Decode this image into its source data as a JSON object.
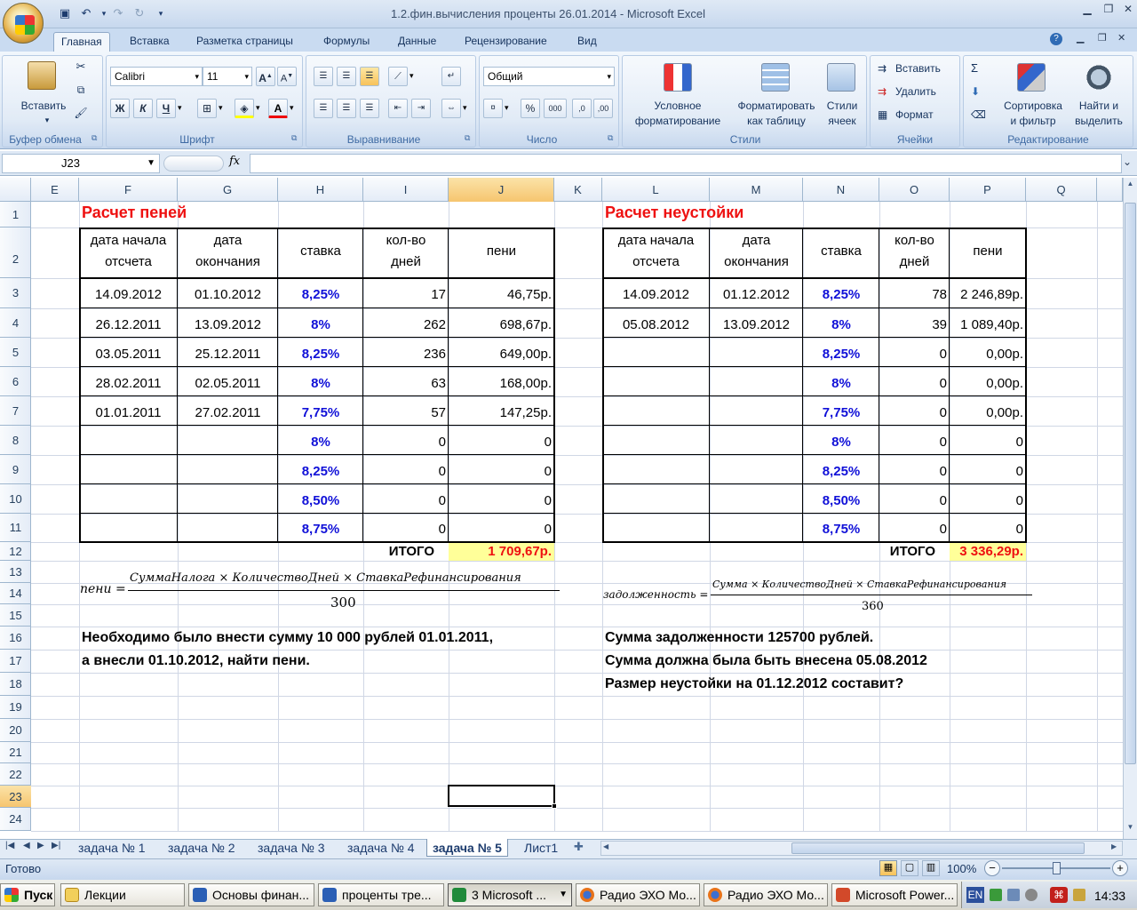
{
  "window": {
    "title": "1.2.фин.вычисления проценты 26.01.2014 - Microsoft Excel"
  },
  "ribbon": {
    "tabs": [
      "Главная",
      "Вставка",
      "Разметка страницы",
      "Формулы",
      "Данные",
      "Рецензирование",
      "Вид"
    ],
    "groups": {
      "clipboard": {
        "label": "Буфер обмена",
        "paste": "Вставить"
      },
      "font": {
        "label": "Шрифт",
        "font_name": "Calibri",
        "font_size": "11",
        "bold": "Ж",
        "italic": "К",
        "underline": "Ч"
      },
      "alignment": {
        "label": "Выравнивание"
      },
      "number": {
        "label": "Число",
        "format": "Общий",
        "percent": "%",
        "thousands": "000"
      },
      "styles": {
        "label": "Стили",
        "conditional_1": "Условное",
        "conditional_2": "форматирование",
        "as_table_1": "Форматировать",
        "as_table_2": "как таблицу",
        "cell_styles_1": "Стили",
        "cell_styles_2": "ячеек"
      },
      "cells": {
        "label": "Ячейки",
        "insert": "Вставить",
        "delete": "Удалить",
        "format": "Формат"
      },
      "editing": {
        "label": "Редактирование",
        "sort_1": "Сортировка",
        "sort_2": "и фильтр",
        "find_1": "Найти и",
        "find_2": "выделить"
      }
    }
  },
  "formula_bar": {
    "name_box": "J23",
    "fx": "fx",
    "value": ""
  },
  "columns": [
    "E",
    "F",
    "G",
    "H",
    "I",
    "J",
    "K",
    "L",
    "M",
    "N",
    "O",
    "P",
    "Q"
  ],
  "rows": [
    "1",
    "2",
    "3",
    "4",
    "5",
    "6",
    "7",
    "8",
    "9",
    "10",
    "11",
    "12",
    "13",
    "14",
    "15",
    "16",
    "17",
    "18",
    "19",
    "20",
    "21",
    "22",
    "23",
    "24"
  ],
  "left_table": {
    "title": "Расчет пеней",
    "headers": [
      [
        "дата начала",
        "отсчета"
      ],
      [
        "дата",
        "окончания"
      ],
      [
        "ставка",
        ""
      ],
      [
        "кол-во",
        "дней"
      ],
      [
        "пени",
        ""
      ]
    ],
    "rows": [
      [
        "14.09.2012",
        "01.10.2012",
        "8,25%",
        "17",
        "46,75р."
      ],
      [
        "26.12.2011",
        "13.09.2012",
        "8%",
        "262",
        "698,67р."
      ],
      [
        "03.05.2011",
        "25.12.2011",
        "8,25%",
        "236",
        "649,00р."
      ],
      [
        "28.02.2011",
        "02.05.2011",
        "8%",
        "63",
        "168,00р."
      ],
      [
        "01.01.2011",
        "27.02.2011",
        "7,75%",
        "57",
        "147,25р."
      ],
      [
        "",
        "",
        "8%",
        "0",
        "0"
      ],
      [
        "",
        "",
        "8,25%",
        "0",
        "0"
      ],
      [
        "",
        "",
        "8,50%",
        "0",
        "0"
      ],
      [
        "",
        "",
        "8,75%",
        "0",
        "0"
      ]
    ],
    "total_label": "ИТОГО",
    "total_value": "1 709,67р.",
    "formula": {
      "lhs": "пени =",
      "numerator": "СуммаНалога × КоличествоДней × СтавкаРефинансирования",
      "denominator": "300"
    },
    "note_1": "Необходимо было внести сумму 10 000 рублей 01.01.2011,",
    "note_2": "а внесли 01.10.2012, найти пени."
  },
  "right_table": {
    "title": "Расчет неустойки",
    "headers": [
      [
        "дата начала",
        "отсчета"
      ],
      [
        "дата",
        "окончания"
      ],
      [
        "ставка",
        ""
      ],
      [
        "кол-во",
        "дней"
      ],
      [
        "пени",
        ""
      ]
    ],
    "rows": [
      [
        "14.09.2012",
        "01.12.2012",
        "8,25%",
        "78",
        "2 246,89р."
      ],
      [
        "05.08.2012",
        "13.09.2012",
        "8%",
        "39",
        "1 089,40р."
      ],
      [
        "",
        "",
        "8,25%",
        "0",
        "0,00р."
      ],
      [
        "",
        "",
        "8%",
        "0",
        "0,00р."
      ],
      [
        "",
        "",
        "7,75%",
        "0",
        "0,00р."
      ],
      [
        "",
        "",
        "8%",
        "0",
        "0"
      ],
      [
        "",
        "",
        "8,25%",
        "0",
        "0"
      ],
      [
        "",
        "",
        "8,50%",
        "0",
        "0"
      ],
      [
        "",
        "",
        "8,75%",
        "0",
        "0"
      ]
    ],
    "total_label": "ИТОГО",
    "total_value": "3 336,29р.",
    "formula": {
      "lhs": "задолженность =",
      "numerator": "Сумма × КоличествоДней × СтавкаРефинансирования",
      "denominator": "360"
    },
    "note_1": "Сумма задолженности 125700 рублей.",
    "note_2": "Сумма должна была быть внесена 05.08.2012",
    "note_3": "Размер неустойки на 01.12.2012 составит?"
  },
  "sheet_tabs": [
    "задача № 1",
    "задача № 2",
    "задача № 3",
    "задача № 4",
    "задача № 5",
    "Лист1"
  ],
  "active_sheet": "задача № 5",
  "status": {
    "ready": "Готово",
    "zoom": "100%"
  },
  "taskbar": {
    "start": "Пуск",
    "buttons": [
      "Лекции",
      "Основы финан...",
      "проценты тре...",
      "3 Microsoft ...",
      "Радио ЭХО Мо...",
      "Радио ЭХО Мо...",
      "Microsoft Power..."
    ],
    "lang": "EN",
    "clock": "14:33"
  },
  "colors": {
    "accent_red": "#ee1111",
    "accent_blue": "#1010d8",
    "total_fill": "#ffff99"
  }
}
